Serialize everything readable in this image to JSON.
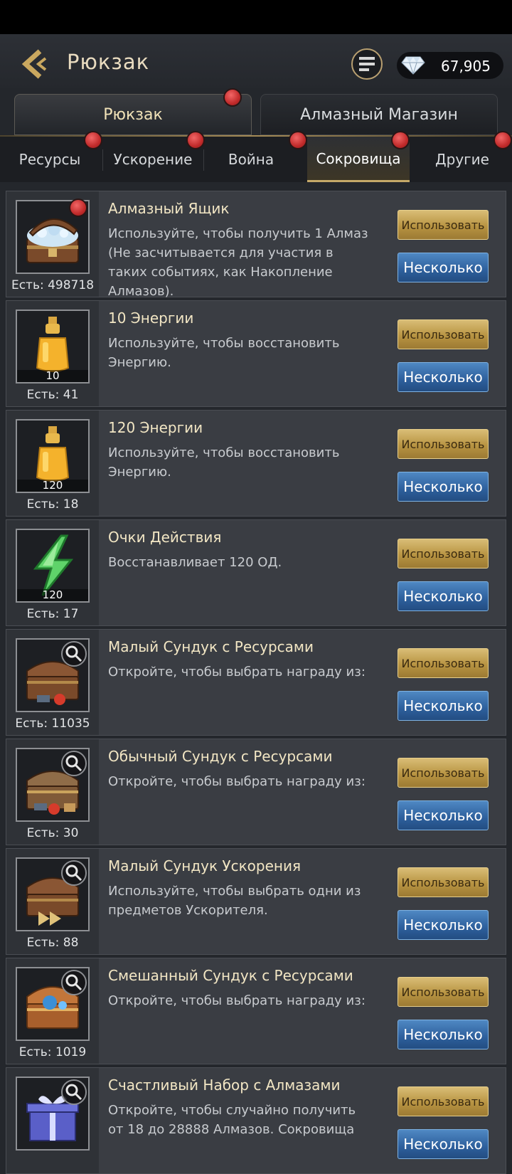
{
  "header": {
    "title": "Рюкзак",
    "currency_amount": "67,905",
    "back_icon": "back-chevron-icon",
    "menu_icon": "list-icon",
    "currency_icon": "diamond-icon"
  },
  "main_tabs": [
    {
      "label": "Рюкзак",
      "active": true
    },
    {
      "label": "Алмазный Магазин",
      "active": false
    }
  ],
  "sub_tabs": [
    {
      "label": "Ресурсы"
    },
    {
      "label": "Ускорение"
    },
    {
      "label": "Война"
    },
    {
      "label": "Сокровища"
    },
    {
      "label": "Другие"
    }
  ],
  "buttons": {
    "use": "Использовать",
    "multi": "Несколько"
  },
  "items": [
    {
      "name": "Алмазный Ящик",
      "desc": "Используйте, чтобы получить 1 Алмаз (Не засчитывается для участия в таких событиях, как Накопление Алмазов).",
      "own": "Есть: 498718",
      "icon_label": "",
      "icon": "diamond-chest-icon"
    },
    {
      "name": "10 Энергии",
      "desc": "Используйте, чтобы восстановить Энергию.",
      "own": "Есть: 41",
      "icon_label": "10",
      "icon": "energy-potion-icon"
    },
    {
      "name": "120 Энергии",
      "desc": "Используйте, чтобы восстановить Энергию.",
      "own": "Есть: 18",
      "icon_label": "120",
      "icon": "energy-potion-icon"
    },
    {
      "name": "Очки Действия",
      "desc": "Восстанавливает 120 ОД.",
      "own": "Есть: 17",
      "icon_label": "120",
      "icon": "lightning-icon"
    },
    {
      "name": "Малый Сундук с Ресурсами",
      "desc": "Откройте, чтобы выбрать награду из:",
      "own": "Есть: 11035",
      "icon_label": "",
      "icon": "resource-chest-icon"
    },
    {
      "name": "Обычный Сундук с Ресурсами",
      "desc": "Откройте, чтобы выбрать награду из:",
      "own": "Есть: 30",
      "icon_label": "",
      "icon": "resource-chest-icon"
    },
    {
      "name": "Малый Сундук Ускорения",
      "desc": "Используйте, чтобы выбрать одни из предметов Ускорителя.",
      "own": "Есть: 88",
      "icon_label": "",
      "icon": "speedup-chest-icon"
    },
    {
      "name": "Смешанный Сундук с Ресурсами",
      "desc": "Откройте, чтобы выбрать награду из:",
      "own": "Есть: 1019",
      "icon_label": "",
      "icon": "mixed-chest-icon"
    },
    {
      "name": "Счастливый Набор с Алмазами",
      "desc": "Откройте, чтобы случайно получить от 18 до 28888 Алмазов. Сокровища",
      "own": "",
      "icon_label": "",
      "icon": "gift-box-icon"
    }
  ],
  "colors": {
    "accent_gold": "#c4a868",
    "button_blue": "#2d5f9c",
    "badge_red": "#c12b2b"
  }
}
